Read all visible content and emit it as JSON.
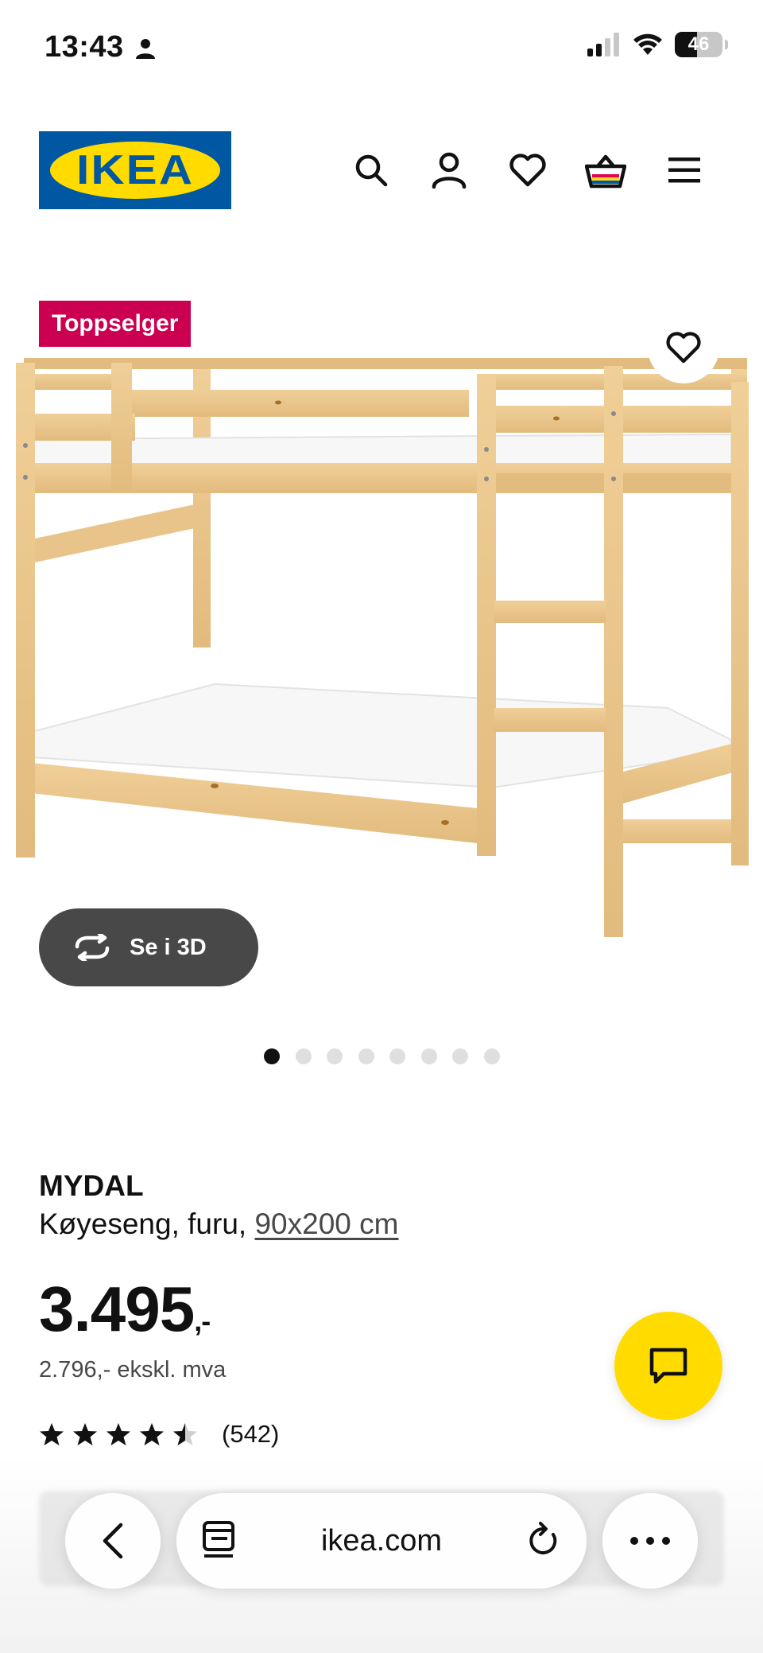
{
  "status_bar": {
    "time": "13:43",
    "battery": "46"
  },
  "header": {
    "logo_text": "IKEA",
    "icons": [
      "search-icon",
      "account-icon",
      "heart-icon",
      "basket-icon",
      "menu-icon"
    ]
  },
  "product": {
    "badge": "Toppselger",
    "view_3d_label": "Se i 3D",
    "image_count": 8,
    "active_image": 1,
    "name": "MYDAL",
    "description": "Køyeseng, furu,",
    "size": "90x200 cm",
    "price_main": "3.495",
    "price_suffix": ",-",
    "price_ex_vat": "2.796,- ekskl. mva",
    "rating": 4.5,
    "rating_max": 5,
    "review_count": "(542)"
  },
  "browser": {
    "url": "ikea.com"
  },
  "colors": {
    "ikea_blue": "#0058a3",
    "ikea_yellow": "#ffdb00",
    "badge_red": "#cc0050",
    "wood": "#e8c48a"
  }
}
